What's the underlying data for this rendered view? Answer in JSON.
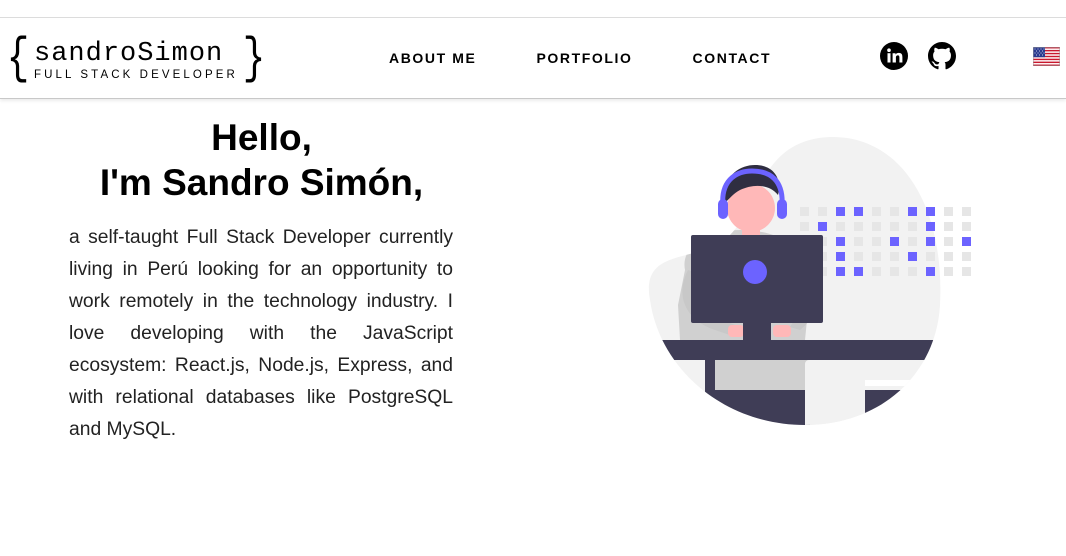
{
  "logo": {
    "open_brace": "{",
    "close_brace": "}",
    "name": "sandroSimon",
    "subtitle": "FULL STACK DEVELOPER"
  },
  "nav": {
    "about": "ABOUT ME",
    "portfolio": "PORTFOLIO",
    "contact": "CONTACT"
  },
  "social": {
    "linkedin_icon": "linkedin-icon",
    "github_icon": "github-icon",
    "language_flag": "us-flag-icon"
  },
  "hero": {
    "greeting": "Hello,",
    "name_line": "I'm Sandro Simón,",
    "description": "a self-taught Full Stack Developer currently living in Perú looking for an opportunity to work remotely in the technology industry. I love developing with the JavaScript ecosystem: React.js, Node.js, Express, and with relational databases like PostgreSQL and MySQL."
  },
  "colors": {
    "accent": "#6c63ff",
    "dark": "#3f3d56",
    "blob": "#f2f2f2"
  }
}
